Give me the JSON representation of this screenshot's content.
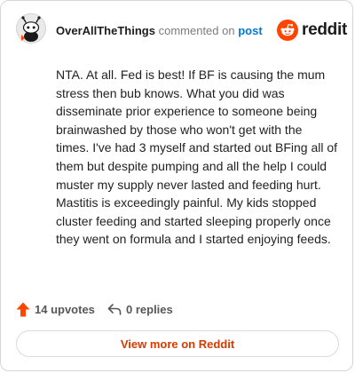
{
  "comment": {
    "username": "OverAllTheThings",
    "action": "commented on",
    "post_link": "post",
    "body": "NTA. At all. Fed is best! If BF is causing the mum stress then bub knows. What you did was disseminate prior experience to someone being brainwashed by those who won't get with the times. I've had 3 myself and started out BFing all of them but despite pumping and all the help I could muster my supply never lasted and feeding hurt. Mastitis is exceedingly painful. My kids stopped cluster feeding and started sleeping properly once they went on formula and I started enjoying feeds.",
    "upvotes": "14 upvotes",
    "replies": "0 replies"
  },
  "brand": {
    "wordmark": "reddit",
    "accent_color": "#ff4500"
  },
  "footer": {
    "view_more_label": "View more on Reddit"
  },
  "icons": {
    "avatar": "avatar-icon",
    "logo": "reddit-logo-icon",
    "upvote": "upvote-arrow-icon",
    "reply": "reply-arrow-icon"
  }
}
